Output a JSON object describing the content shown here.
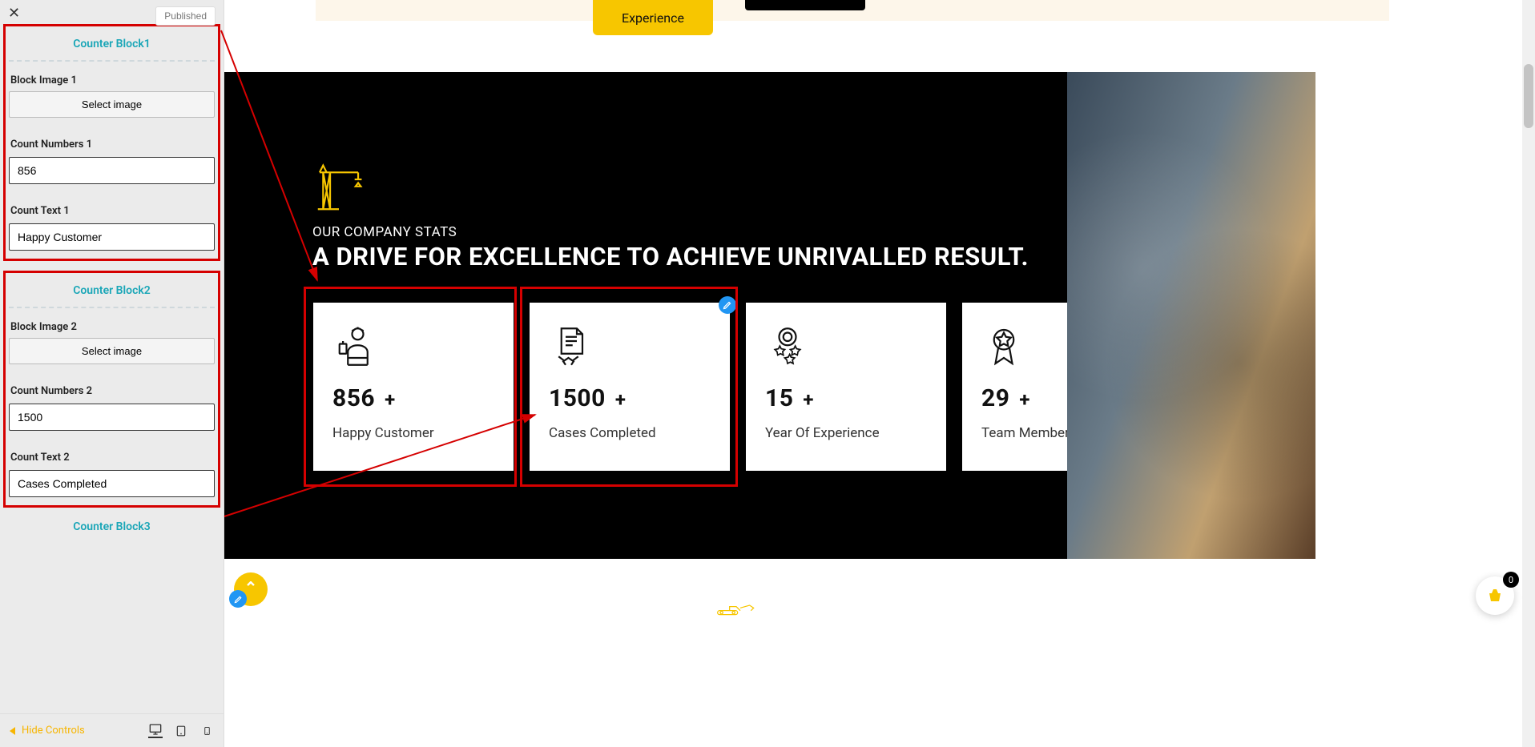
{
  "sidebar": {
    "published_label": "Published",
    "block1": {
      "title": "Counter Block1",
      "img_label": "Block Image 1",
      "select_img": "Select image",
      "num_label": "Count Numbers 1",
      "num_value": "856",
      "text_label": "Count Text 1",
      "text_value": "Happy Customer"
    },
    "block2": {
      "title": "Counter Block2",
      "img_label": "Block Image 2",
      "select_img": "Select image",
      "num_label": "Count Numbers 2",
      "num_value": "1500",
      "text_label": "Count Text 2",
      "text_value": "Cases Completed"
    },
    "block3_title": "Counter Block3",
    "hide_controls": "Hide Controls"
  },
  "top": {
    "experience": "Experience"
  },
  "stats": {
    "subtitle": "OUR COMPANY STATS",
    "title": "A DRIVE FOR EXCELLENCE TO ACHIEVE UNRIVALLED RESULT.",
    "cards": [
      {
        "num": "856",
        "suffix": "+",
        "text": "Happy Customer"
      },
      {
        "num": "1500",
        "suffix": "+",
        "text": "Cases Completed"
      },
      {
        "num": "15",
        "suffix": "+",
        "text": "Year Of Experience"
      },
      {
        "num": "29",
        "suffix": "+",
        "text": "Team Member"
      }
    ]
  },
  "cart": {
    "count": "0"
  }
}
